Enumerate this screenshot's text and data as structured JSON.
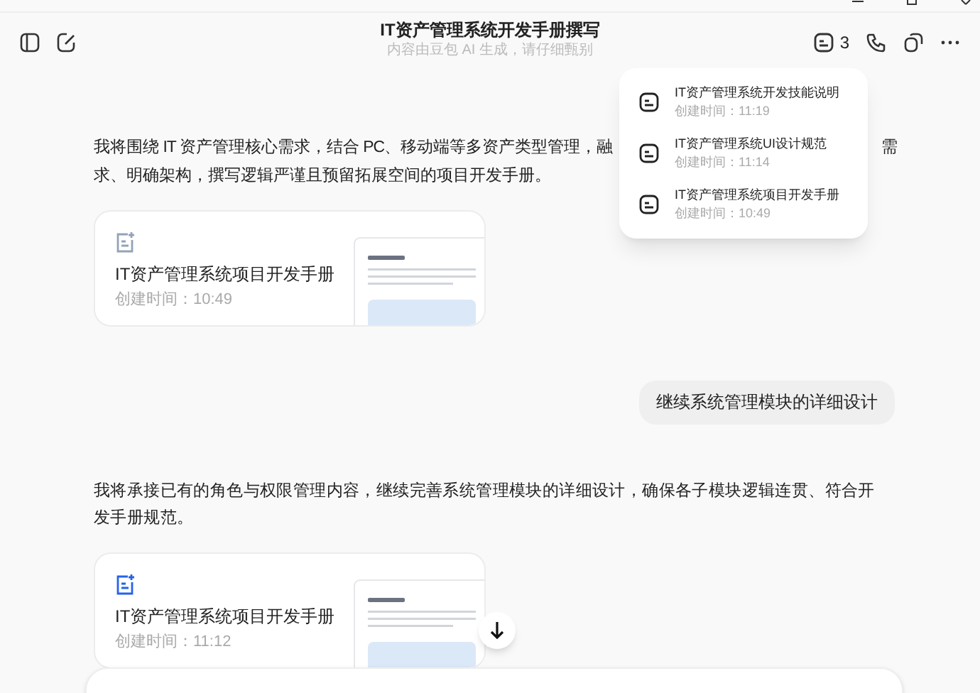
{
  "header": {
    "title": "IT资产管理系统开发手册撰写",
    "subtitle": "内容由豆包 AI 生成，请仔细甄别",
    "docs_count": "3"
  },
  "docs_popup": [
    {
      "title": "IT资产管理系统开发技能说明",
      "time": "创建时间：11:19"
    },
    {
      "title": "IT资产管理系统UI设计规范",
      "time": "创建时间：11:14"
    },
    {
      "title": "IT资产管理系统项目开发手册",
      "time": "创建时间：10:49"
    }
  ],
  "messages": [
    {
      "kind": "assistant",
      "line1": "我将围绕 IT 资产管理核心需求，结合 PC、移动端等多资产类型管理，融",
      "line1_end": "需",
      "line2": "求、明确架构，撰写逻辑严谨且预留拓展空间的项目开发手册。",
      "card": {
        "title": "IT资产管理系统项目开发手册",
        "time": "创建时间：10:49",
        "highlighted": false
      }
    },
    {
      "kind": "user",
      "text": "继续系统管理模块的详细设计"
    },
    {
      "kind": "assistant",
      "text": "我将承接已有的角色与权限管理内容，继续完善系统管理模块的详细设计，确保各子模块逻辑连贯、符合开发手册规范。",
      "card": {
        "title": "IT资产管理系统项目开发手册",
        "time": "创建时间：11:12",
        "highlighted": true
      }
    }
  ]
}
